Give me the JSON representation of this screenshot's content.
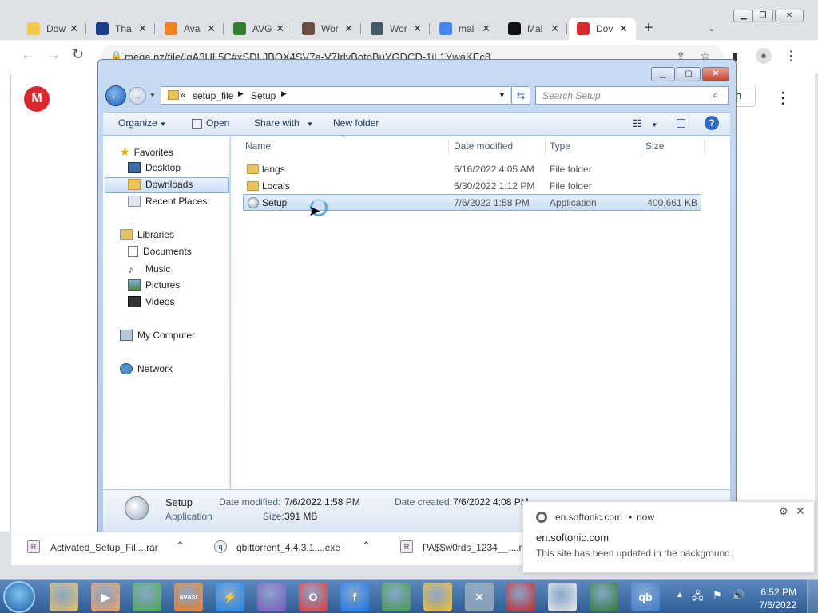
{
  "browser": {
    "tabs": [
      {
        "title": "Dow",
        "icon": "green-download-icon",
        "color": "#f2c94c"
      },
      {
        "title": "Tha",
        "icon": "w-logo-icon",
        "color": "#1a3c8f"
      },
      {
        "title": "Ava",
        "icon": "avast-icon",
        "color": "#f58220"
      },
      {
        "title": "AVG",
        "icon": "avg-icon",
        "color": "#2e7d32"
      },
      {
        "title": "Wor",
        "icon": "people-icon",
        "color": "#6d4c41"
      },
      {
        "title": "Wor",
        "icon": "shield-icon",
        "color": "#455a64"
      },
      {
        "title": "mal",
        "icon": "google-icon",
        "color": "#4285f4"
      },
      {
        "title": "Mal",
        "icon": "cs-icon",
        "color": "#111111"
      },
      {
        "title": "Dov",
        "icon": "mega-icon",
        "color": "#d9272e"
      }
    ],
    "url": "mega.nz/file/IgA3UL5C#xSDLJBOX4SV7a-V7IrlvBotoBuYGDCD-1jL1YwaKEc8",
    "page_button": "n"
  },
  "explorer": {
    "breadcrumb": {
      "prefix": "«",
      "parent": "setup_file",
      "current": "Setup"
    },
    "search_placeholder": "Search Setup",
    "commands": {
      "organize": "Organize",
      "open": "Open",
      "share": "Share with",
      "new_folder": "New folder"
    },
    "nav": {
      "favorites": "Favorites",
      "fav_items": [
        "Desktop",
        "Downloads",
        "Recent Places"
      ],
      "libraries": "Libraries",
      "lib_items": [
        "Documents",
        "Music",
        "Pictures",
        "Videos"
      ],
      "computer": "My Computer",
      "network": "Network"
    },
    "columns": {
      "name": "Name",
      "date": "Date modified",
      "type": "Type",
      "size": "Size"
    },
    "files": [
      {
        "name": "langs",
        "date": "6/16/2022 4:05 AM",
        "type": "File folder",
        "size": ""
      },
      {
        "name": "Locals",
        "date": "6/30/2022 1:12 PM",
        "type": "File folder",
        "size": ""
      },
      {
        "name": "Setup",
        "date": "7/6/2022 1:58 PM",
        "type": "Application",
        "size": "400,661 KB"
      }
    ],
    "details": {
      "name": "Setup",
      "kind": "Application",
      "modified_label": "Date modified:",
      "modified_value": "7/6/2022 1:58 PM",
      "created_label": "Date created:",
      "created_value": "7/6/2022 4:08 PM",
      "size_label": "Size:",
      "size_value": "391 MB"
    }
  },
  "downloads": [
    {
      "name": "Activated_Setup_Fil....rar",
      "icon_text": "R"
    },
    {
      "name": "qbittorrent_4.4.3.1....exe",
      "icon_text": "q"
    },
    {
      "name": "PA$$w0rds_1234__....r",
      "icon_text": "R"
    }
  ],
  "notification": {
    "source": "en.softonic.com",
    "time": "now",
    "title": "en.softonic.com",
    "body": "This site has been updated in the background."
  },
  "taskbar": {
    "apps": [
      {
        "name": "explorer",
        "label": "",
        "color": "#e9c46a"
      },
      {
        "name": "media",
        "label": "▶",
        "color": "#f4a261"
      },
      {
        "name": "chrome",
        "label": "",
        "color": "#4caf50"
      },
      {
        "name": "avast",
        "label": "avast",
        "color": "#f58220"
      },
      {
        "name": "shield",
        "label": "⚡",
        "color": "#1e88e5"
      },
      {
        "name": "tor",
        "label": "",
        "color": "#7e57c2"
      },
      {
        "name": "opera",
        "label": "O",
        "color": "#e53935"
      },
      {
        "name": "facebook",
        "label": "f",
        "color": "#1877f2"
      },
      {
        "name": "app",
        "label": "",
        "color": "#43a047"
      },
      {
        "name": "tor2",
        "label": "",
        "color": "#fbc02d"
      },
      {
        "name": "tools",
        "label": "✕",
        "color": "#90a4ae"
      },
      {
        "name": "game",
        "label": "",
        "color": "#c62828"
      },
      {
        "name": "hat",
        "label": "",
        "color": "#eeeeee"
      },
      {
        "name": "avg",
        "label": "",
        "color": "#2e7d32"
      },
      {
        "name": "qbittorrent",
        "label": "qb",
        "color": "#3f7fd1"
      }
    ],
    "time": "6:52 PM",
    "date": "7/6/2022"
  }
}
